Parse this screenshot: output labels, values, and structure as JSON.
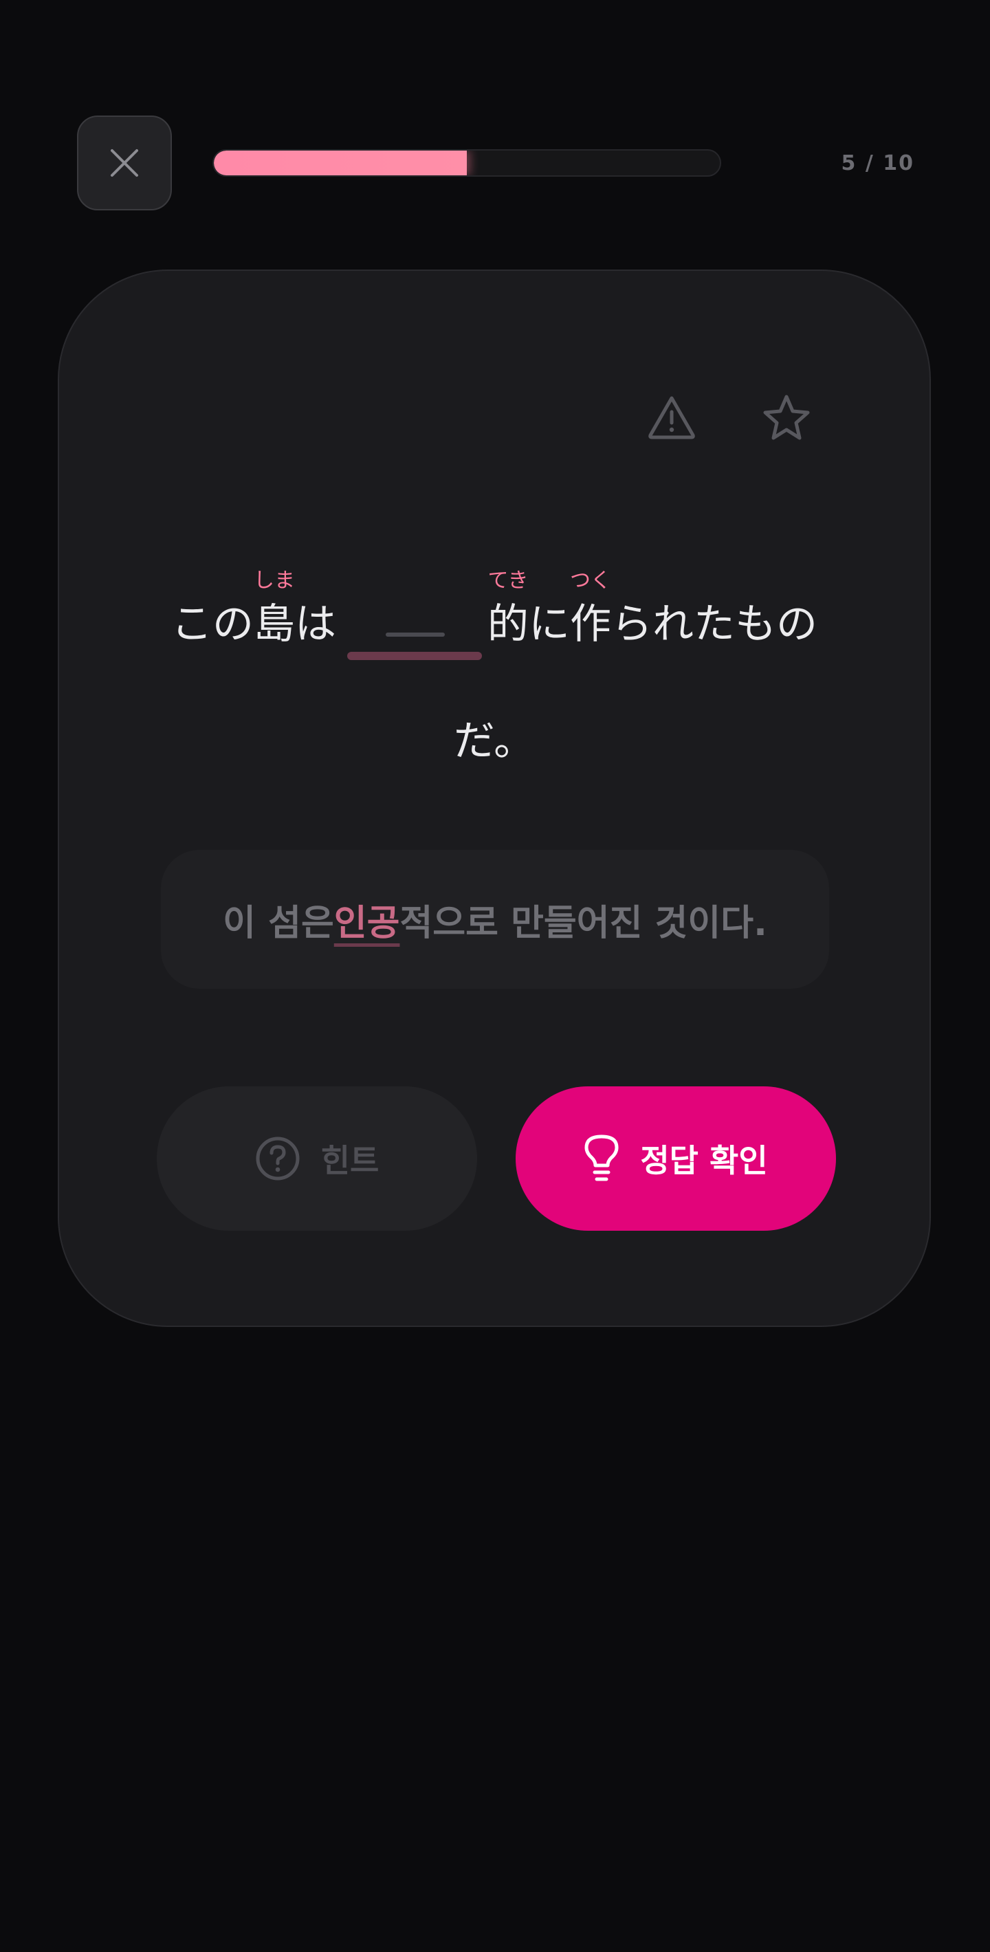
{
  "header": {
    "close_icon": "close-icon",
    "progress": {
      "current": 5,
      "total": 10,
      "fraction": 0.5,
      "label": "5 / 10"
    }
  },
  "card": {
    "actions": [
      {
        "icon": "warning-triangle-icon"
      },
      {
        "icon": "star-icon"
      }
    ],
    "sentence": {
      "part1_a": "この",
      "ruby1_base": "島",
      "ruby1_reading": "しま",
      "part1_b": "は",
      "ruby2_base": "的",
      "ruby2_reading": "てき",
      "part2": "に",
      "ruby3_base": "作",
      "ruby3_reading": "つく",
      "part3": "られたもの",
      "line2": "だ。"
    },
    "translation": {
      "before": "이 섬은 ",
      "highlight": "인공",
      "after": "적으로 만들어진 것이다."
    },
    "buttons": {
      "hint_label": "힌트",
      "hint_icon": "question-circle-icon",
      "check_label": "정답 확인",
      "check_icon": "lightbulb-icon"
    }
  },
  "colors": {
    "background": "#0b0b0d",
    "card": "#1b1b1e",
    "accent": "#e2047a",
    "progress": "#ff8aa8",
    "furigana": "#ff7a9b"
  }
}
